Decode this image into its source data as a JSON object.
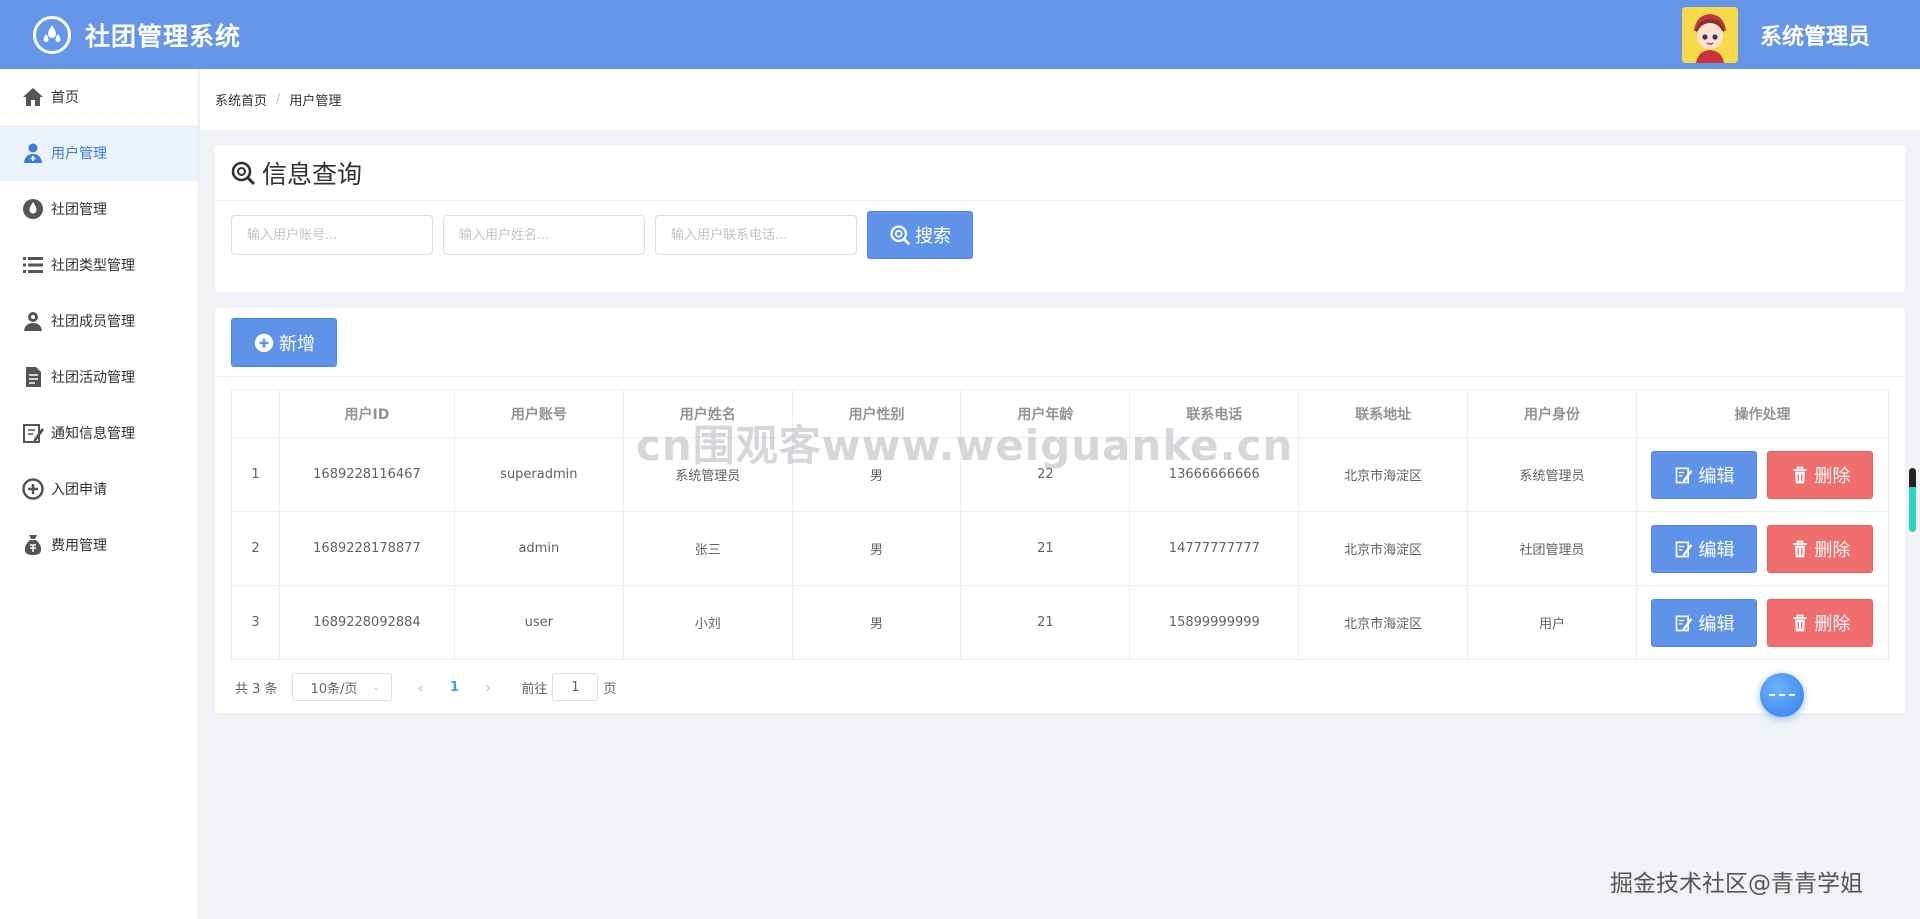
{
  "header": {
    "title": "社团管理系统",
    "username": "系统管理员",
    "logo_icon": "drops-icon",
    "colors": {
      "header_bg": "#6596e8"
    }
  },
  "sidebar": {
    "items": [
      {
        "label": "首页",
        "icon": "home-icon"
      },
      {
        "label": "用户管理",
        "icon": "user-icon",
        "active": true
      },
      {
        "label": "社团管理",
        "icon": "drop-icon"
      },
      {
        "label": "社团类型管理",
        "icon": "list-icon"
      },
      {
        "label": "社团成员管理",
        "icon": "member-icon"
      },
      {
        "label": "社团活动管理",
        "icon": "document-icon"
      },
      {
        "label": "通知信息管理",
        "icon": "edit-note-icon"
      },
      {
        "label": "入团申请",
        "icon": "add-circle-icon"
      },
      {
        "label": "费用管理",
        "icon": "money-bag-icon"
      }
    ]
  },
  "breadcrumb": {
    "home": "系统首页",
    "separator": "/",
    "current": "用户管理"
  },
  "search": {
    "title": "信息查询",
    "account_placeholder": "输入用户账号...",
    "name_placeholder": "输入用户姓名...",
    "phone_placeholder": "输入用户联系电话...",
    "search_label": "搜索"
  },
  "toolbar": {
    "add_label": "新增"
  },
  "table": {
    "headers": [
      "",
      "用户ID",
      "用户账号",
      "用户姓名",
      "用户性别",
      "用户年龄",
      "联系电话",
      "联系地址",
      "用户身份",
      "操作处理"
    ],
    "rows": [
      {
        "index": "1",
        "id": "1689228116467",
        "account": "superadmin",
        "name": "系统管理员",
        "gender": "男",
        "age": "22",
        "phone": "13666666666",
        "address": "北京市海淀区",
        "role": "系统管理员"
      },
      {
        "index": "2",
        "id": "1689228178877",
        "account": "admin",
        "name": "张三",
        "gender": "男",
        "age": "21",
        "phone": "14777777777",
        "address": "北京市海淀区",
        "role": "社团管理员"
      },
      {
        "index": "3",
        "id": "1689228092884",
        "account": "user",
        "name": "小刘",
        "gender": "男",
        "age": "21",
        "phone": "15899999999",
        "address": "北京市海淀区",
        "role": "用户"
      }
    ],
    "edit_label": "编辑",
    "delete_label": "删除"
  },
  "pager": {
    "total": "共 3 条",
    "page_size": "10条/页",
    "current_page": "1",
    "goto_prefix": "前往",
    "goto_value": "1",
    "goto_suffix": "页"
  },
  "watermarks": {
    "center": "cn围观客www.weiguanke.cn",
    "corner": "掘金技术社区@青青学姐"
  }
}
